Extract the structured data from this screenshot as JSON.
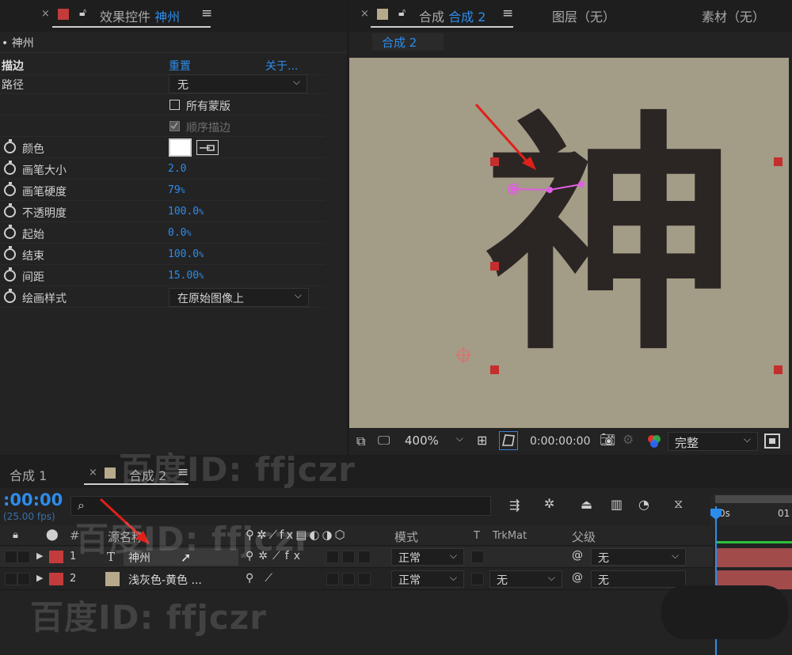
{
  "colors": {
    "accent": "#2d8ceb",
    "red_swatch": "#c43b3b",
    "comp_swatch": "#b7a98b",
    "comp_background": "#a39c86",
    "arrow": "#e0201a",
    "path": "#e060e0"
  },
  "effect_controls": {
    "tab_close": "×",
    "tab_label": "效果控件",
    "tab_layer": "神州",
    "breadcrumb": "• 神州",
    "effect_name": "描边",
    "reset": "重置",
    "about": "关于...",
    "path_label": "路径",
    "path_value": "无",
    "all_masks": "所有蒙版",
    "stroke_sequentially": "顺序描边",
    "params": [
      {
        "label": "颜色"
      },
      {
        "label": "画笔大小",
        "value": "2.0",
        "unit": ""
      },
      {
        "label": "画笔硬度",
        "value": "79",
        "unit": "%"
      },
      {
        "label": "不透明度",
        "value": "100.0",
        "unit": "%"
      },
      {
        "label": "起始",
        "value": "0.0",
        "unit": "%"
      },
      {
        "label": "结束",
        "value": "100.0",
        "unit": "%"
      },
      {
        "label": "间距",
        "value": "15.00",
        "unit": "%"
      },
      {
        "label": "绘画样式"
      }
    ],
    "paint_style_value": "在原始图像上"
  },
  "composition": {
    "tab_close": "×",
    "tab_label": "合成",
    "tab_name": "合成 2",
    "layer_tab": "图层（无）",
    "footage_tab": "素材（无）",
    "subtab": "合成 2",
    "glyph": "神",
    "toolbar": {
      "zoom": "400%",
      "timecode": "0:00:00:00",
      "resolution": "完整"
    }
  },
  "timeline": {
    "tab1": "合成 1",
    "tab2_close": "×",
    "tab2": "合成 2",
    "timecode": ":00:00",
    "fps": "(25.00 fps)",
    "search_icon": "⌕",
    "columns": {
      "num": "#",
      "source_name": "源名称",
      "mode": "模式",
      "t": "T",
      "trkmat": "TrkMat",
      "parent": "父级"
    },
    "ruler": {
      "start": "0s",
      "next": "01"
    },
    "layers": [
      {
        "num": "1",
        "type_icon": "T",
        "name": "神州",
        "mode": "正常",
        "trkmat": "",
        "parent": "无"
      },
      {
        "num": "2",
        "type_icon": "",
        "name": "浅灰色-黄色 ...",
        "mode": "正常",
        "trkmat": "无",
        "parent": "无"
      }
    ]
  },
  "watermark": "百度ID: ffjczr"
}
